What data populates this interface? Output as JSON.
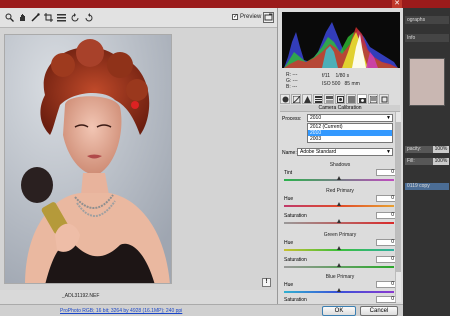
{
  "window": {
    "close_glyph": "✕"
  },
  "toolbar": {
    "tools": [
      "zoom-icon",
      "hand-icon",
      "white-balance-icon",
      "crop-icon",
      "list-icon",
      "rotate-left-icon",
      "rotate-right-icon"
    ],
    "preview_label": "Preview",
    "preview_checked": "✓"
  },
  "image": {
    "filename": "_ADL31192.NEF"
  },
  "histogram": {
    "rgb": {
      "r": "R:",
      "g": "G:",
      "b": "B:",
      "dash": "---"
    },
    "exif": {
      "aperture": "f/11",
      "shutter": "1/80 s",
      "iso": "ISO 500",
      "focal": "85 mm"
    }
  },
  "panel": {
    "title": "Camera Calibration",
    "process": {
      "label": "Process:",
      "value": "2010",
      "options": [
        "2012 (Current)",
        "2010",
        "2003"
      ],
      "selected_index": 1
    },
    "name": {
      "label": "Name:",
      "value": "Adobe Standard"
    },
    "shadows": {
      "title": "Shadows",
      "tint_label": "Tint",
      "tint_value": "0"
    },
    "red": {
      "title": "Red Primary",
      "hue_label": "Hue",
      "hue_value": "0",
      "sat_label": "Saturation",
      "sat_value": "0"
    },
    "green": {
      "title": "Green Primary",
      "hue_label": "Hue",
      "hue_value": "0",
      "sat_label": "Saturation",
      "sat_value": "0"
    },
    "blue": {
      "title": "Blue Primary",
      "hue_label": "Hue",
      "hue_value": "0",
      "sat_label": "Saturation",
      "sat_value": "0"
    }
  },
  "status": {
    "workflow": "ProPhoto RGB; 16 bit; 3264 by 4928 (16.1MP); 240 ppi",
    "ok_label": "OK",
    "cancel_label": "Cancel"
  },
  "ps_dock": {
    "tab1": "ographs",
    "tab2": "Info",
    "opacity_label": "pacity:",
    "opacity_value": "100%",
    "fill_label": "Fill:",
    "fill_value": "100%",
    "layer_label": "0119 copy"
  },
  "colors": {
    "accent": "#3399ff",
    "ok_border": "#3c7fb1",
    "link": "#1a46c8"
  }
}
